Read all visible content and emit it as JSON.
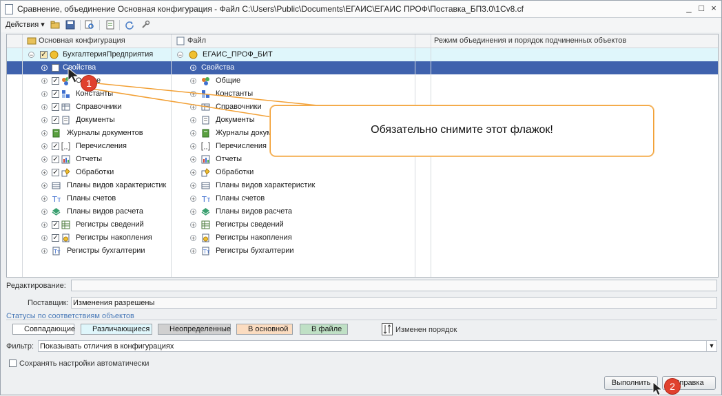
{
  "window": {
    "title": "Сравнение, объединение Основная конфигурация - Файл C:\\Users\\Public\\Documents\\ЕГАИС\\ЕГАИС ПРОФ\\Поставка_БП3.0\\1Cv8.cf",
    "controls": [
      "_",
      "□",
      "×"
    ]
  },
  "toolbar": {
    "actions_label": "Действия"
  },
  "grid": {
    "headers": {
      "main_config": "Основная конфигурация",
      "file": "Файл",
      "merge_mode": "Режим объединения и порядок подчиненных объектов"
    },
    "root": {
      "left": "БухгалтерияПредприятия",
      "right": "ЕГАИС_ПРОФ_БИТ"
    },
    "rows": [
      {
        "left": "Свойства",
        "right": "Свойства",
        "icon": "none",
        "checked": false
      },
      {
        "left": "Общие",
        "right": "Общие",
        "icon": "general",
        "checked": true
      },
      {
        "left": "Константы",
        "right": "Константы",
        "icon": "constants",
        "checked": true
      },
      {
        "left": "Справочники",
        "right": "Справочники",
        "icon": "catalog",
        "checked": true
      },
      {
        "left": "Документы",
        "right": "Документы",
        "icon": "document",
        "checked": true
      },
      {
        "left": "Журналы документов",
        "right": "Журналы документов",
        "icon": "journal",
        "checked": null
      },
      {
        "left": "Перечисления",
        "right": "Перечисления",
        "icon": "enum",
        "checked": true
      },
      {
        "left": "Отчеты",
        "right": "Отчеты",
        "icon": "report",
        "checked": true
      },
      {
        "left": "Обработки",
        "right": "Обработки",
        "icon": "processing",
        "checked": true
      },
      {
        "left": "Планы видов характеристик",
        "right": "Планы видов характеристик",
        "icon": "chartypes",
        "checked": null
      },
      {
        "left": "Планы счетов",
        "right": "Планы счетов",
        "icon": "accounts",
        "checked": null
      },
      {
        "left": "Планы видов расчета",
        "right": "Планы видов расчета",
        "icon": "calctypes",
        "checked": null
      },
      {
        "left": "Регистры сведений",
        "right": "Регистры сведений",
        "icon": "inforeg",
        "checked": true
      },
      {
        "left": "Регистры накопления",
        "right": "Регистры накопления",
        "icon": "accumreg",
        "checked": true
      },
      {
        "left": "Регистры бухгалтерии",
        "right": "Регистры бухгалтерии",
        "icon": "acctreg",
        "checked": null
      }
    ]
  },
  "callout": {
    "text": "Обязательно снимите этот флажок!",
    "badge1": "1",
    "badge2": "2"
  },
  "form": {
    "edit_label": "Редактирование:",
    "edit_value": "",
    "supplier_label": "Поставщик:",
    "supplier_value": "Изменения разрешены",
    "statuses_title": "Статусы по соответствиям объектов",
    "statuses": [
      {
        "label": "Совпадающие",
        "color": "#ffffff"
      },
      {
        "label": "Различающиеся",
        "color": "#dff6fb"
      },
      {
        "label": "Неопределенные",
        "color": "#d0d0d0"
      },
      {
        "label": "В основной",
        "color": "#fbdcc0"
      },
      {
        "label": "В файле",
        "color": "#bfe0c5"
      }
    ],
    "order_changed": "Изменен порядок",
    "filter_label": "Фильтр:",
    "filter_value": "Показывать отличия в конфигурациях",
    "save_settings": "Сохранять настройки автоматически",
    "run_button": "Выполнить",
    "help_button": "Справка"
  },
  "colors": {
    "selection": "#3f62ad",
    "accent": "#f2a035",
    "badge": "#e0412e"
  }
}
